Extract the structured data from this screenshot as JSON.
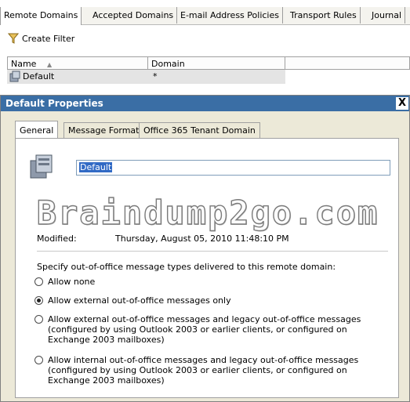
{
  "top_tabs": [
    "Remote Domains",
    "Accepted Domains",
    "E-mail Address Policies",
    "Transport Rules",
    "Journal"
  ],
  "toolbar": {
    "create_filter_label": "Create Filter",
    "filter_icon": "funnel-icon"
  },
  "grid": {
    "columns": [
      "Name",
      "Domain"
    ],
    "rows": [
      {
        "name": "Default",
        "domain": "*"
      }
    ]
  },
  "dialog": {
    "title": "Default Properties",
    "close_label": "X",
    "tabs": [
      "General",
      "Message Format",
      "Office 365 Tenant Domain"
    ],
    "name_value": "Default",
    "watermark": "Braindump2go.com",
    "modified_label": "Modified:",
    "modified_value": "Thursday, August 05, 2010 11:48:10 PM",
    "oof_question": "Specify out-of-office message types delivered to this remote domain:",
    "oof_options": [
      {
        "label": "Allow none",
        "checked": false
      },
      {
        "label": "Allow external out-of-office messages only",
        "checked": true
      },
      {
        "label": "Allow external out-of-office messages and legacy out-of-office messages (configured by using Outlook 2003 or earlier clients, or configured on Exchange 2003 mailboxes)",
        "checked": false
      },
      {
        "label": "Allow internal out-of-office messages and legacy out-of-office messages (configured by using Outlook 2003 or earlier clients, or configured on Exchange 2003 mailboxes)",
        "checked": false
      }
    ]
  },
  "colors": {
    "title_bar": "#3a6ea5",
    "dialog_bg": "#ece9d8",
    "selection": "#316ac5"
  }
}
